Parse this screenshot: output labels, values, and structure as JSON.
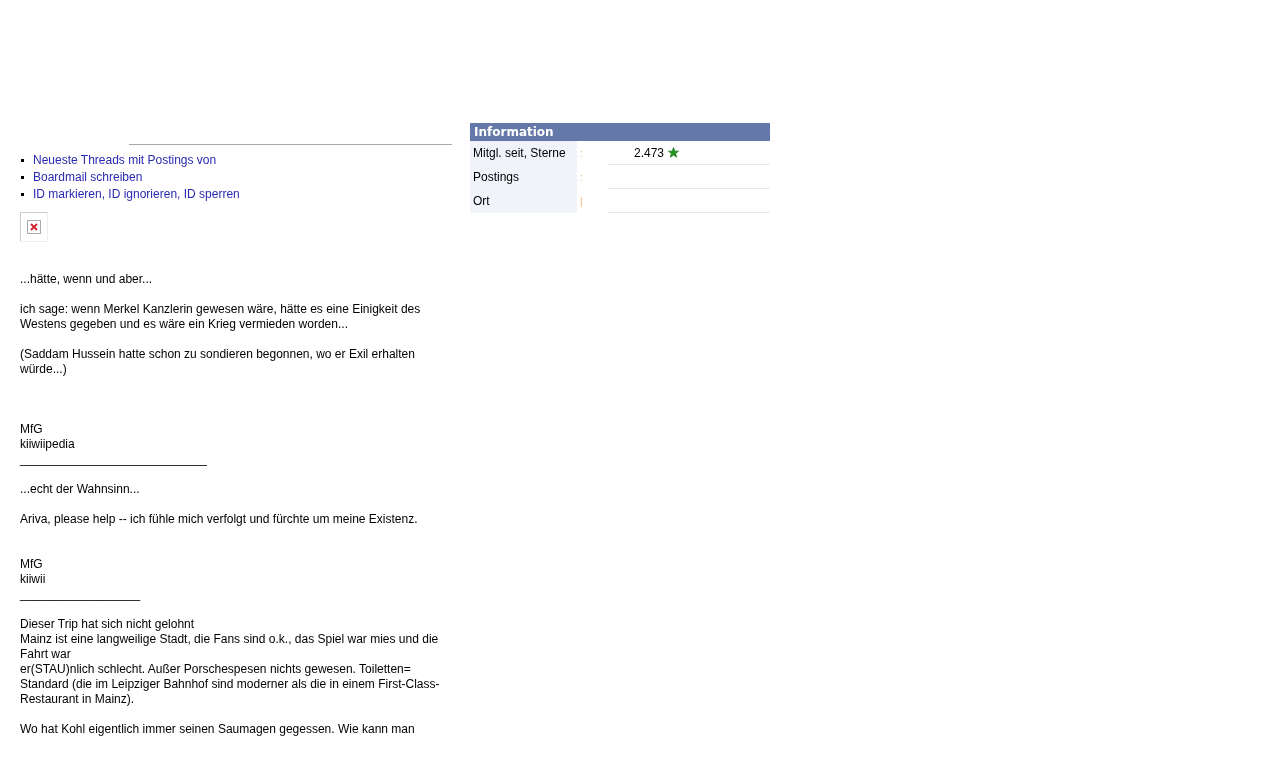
{
  "links": [
    {
      "text": "Neueste Threads mit Postings von"
    },
    {
      "text": "Boardmail schreiben"
    },
    {
      "text": "ID markieren, ID ignorieren, ID sperren"
    }
  ],
  "signature": [
    {
      "kind": "text",
      "text": "...hätte, wenn und aber..."
    },
    {
      "kind": "blank"
    },
    {
      "kind": "text",
      "text": "ich sage: wenn Merkel Kanzlerin gewesen wäre, hätte es eine Einigkeit des Westens gegeben und es wäre ein Krieg vermieden worden..."
    },
    {
      "kind": "blank"
    },
    {
      "kind": "text",
      "text": "(Saddam Hussein hatte schon zu sondieren begonnen, wo er Exil erhalten würde...)"
    },
    {
      "kind": "blank"
    },
    {
      "kind": "blank"
    },
    {
      "kind": "blank"
    },
    {
      "kind": "text",
      "text": "MfG"
    },
    {
      "kind": "text",
      "text": "kiiwiipedia"
    },
    {
      "kind": "text",
      "text": "____________________________"
    },
    {
      "kind": "blank"
    },
    {
      "kind": "text",
      "text": "...echt der Wahnsinn..."
    },
    {
      "kind": "blank"
    },
    {
      "kind": "text",
      "text": "Ariva, please help -- ich fühle mich verfolgt und fürchte um meine Existenz."
    },
    {
      "kind": "blank"
    },
    {
      "kind": "blank"
    },
    {
      "kind": "text",
      "text": "MfG"
    },
    {
      "kind": "text",
      "text": "kiiwii"
    },
    {
      "kind": "text",
      "text": "__________________"
    },
    {
      "kind": "blank"
    },
    {
      "kind": "text",
      "text": "Dieser Trip hat sich nicht gelohnt"
    },
    {
      "kind": "text",
      "text": "Mainz ist eine langweilige Stadt, die Fans sind o.k., das Spiel war mies und die Fahrt war"
    },
    {
      "kind": "text",
      "text": "er(STAU)nlich schlecht. Außer Porschespesen nichts gewesen. Toiletten= Standard (die im Leipziger Bahnhof sind moderner als die in einem First-Class-Restaurant in Mainz)."
    },
    {
      "kind": "blank"
    },
    {
      "kind": "text",
      "text": "Wo hat Kohl eigentlich immer seinen Saumagen gegessen. Wie kann man"
    }
  ],
  "information": {
    "title": "Information",
    "rows": [
      {
        "label": "Mitgl. seit, Sterne",
        "separator": ":",
        "value": "2.473",
        "rank_icon": true
      },
      {
        "label": "Postings",
        "separator": ":"
      },
      {
        "label": "Ort",
        "separator": "|"
      }
    ]
  }
}
